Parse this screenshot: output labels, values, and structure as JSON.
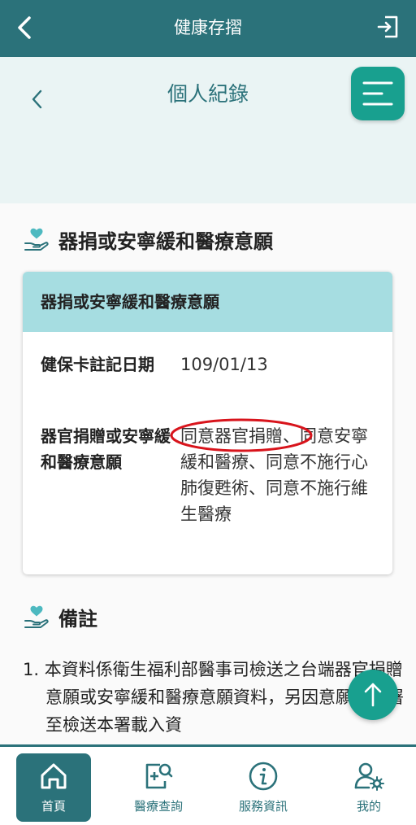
{
  "header": {
    "title": "健康存摺",
    "back_icon": "chevron-left-icon",
    "logout_icon": "logout-icon"
  },
  "subheader": {
    "title": "個人紀錄",
    "back_icon": "chevron-left-icon",
    "menu_icon": "hamburger-icon"
  },
  "section1": {
    "title": "器捐或安寧緩和醫療意願",
    "icon": "heart-hand-icon",
    "card": {
      "header": "器捐或安寧緩和醫療意願",
      "rows": [
        {
          "label": "健保卡註記日期",
          "value": "109/01/13"
        },
        {
          "label": "器官捐贈或安寧緩和醫療意願",
          "value": "同意器官捐贈、同意安寧緩和醫療、同意不施行心肺復甦術、同意不施行維生醫療"
        }
      ]
    }
  },
  "section2": {
    "title": "備註",
    "icon": "heart-hand-icon",
    "note": "1. 本資料係衛生福利部醫事司檢送之台端器官捐贈意願或安寧緩和醫療意願資料，另因意願書簽署至檢送本署載入資"
  },
  "fab": {
    "icon": "arrow-up-icon"
  },
  "bottom_nav": [
    {
      "label": "首頁",
      "icon": "home-icon",
      "active": true
    },
    {
      "label": "醫療查詢",
      "icon": "medical-search-icon",
      "active": false
    },
    {
      "label": "服務資訊",
      "icon": "info-icon",
      "active": false
    },
    {
      "label": "我的",
      "icon": "user-settings-icon",
      "active": false
    }
  ],
  "colors": {
    "primary": "#2b727a",
    "accent": "#18a08f",
    "card_header": "#a6dde1",
    "highlight": "#d8141c"
  }
}
